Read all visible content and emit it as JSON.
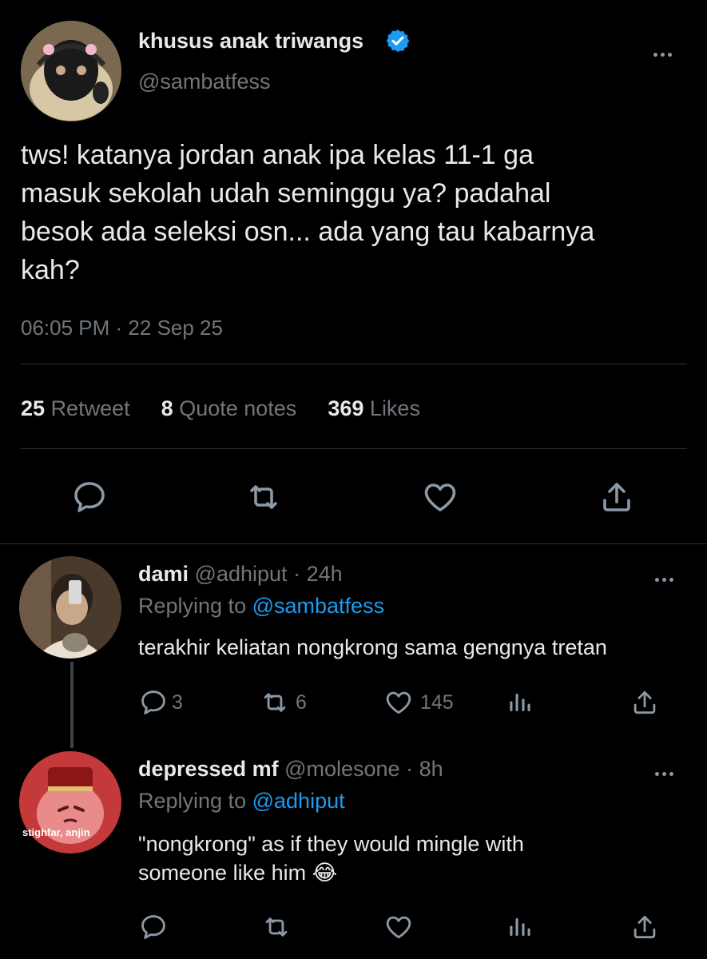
{
  "tweet": {
    "display_name": "khusus anak triwangs",
    "handle": "@sambatfess",
    "text_lines": [
      "tws! katanya jordan anak ipa kelas 11-1 ga",
      "masuk sekolah udah seminggu ya? padahal",
      "besok ada seleksi osn... ada yang tau kabarnya",
      "kah?"
    ],
    "time": "06:05 PM",
    "date": "22 Sep 25",
    "stats": {
      "retweets": "25",
      "retweets_label": "Retweet",
      "quotes": "8",
      "quotes_label": "Quote notes",
      "likes": "369",
      "likes_label": "Likes"
    }
  },
  "replies": [
    {
      "name": "dami",
      "handle": "@adhiput",
      "time": "24h",
      "replying_prefix": "Replying to",
      "replying_to": "@sambatfess",
      "text_lines": [
        "terakhir keliatan nongkrong sama gengnya tretan"
      ],
      "replies": "3",
      "retweets": "6",
      "likes": "145"
    },
    {
      "name": "depressed mf",
      "handle": "@molesone",
      "time": "8h",
      "replying_prefix": "Replying to",
      "replying_to": "@adhiput",
      "text_lines": [
        "\"nongkrong\" as if they would mingle with",
        "someone like him"
      ],
      "emoji": "😂",
      "avatar_caption": "stighfar, anjin"
    }
  ],
  "icons": [
    "verified-badge-icon",
    "more-icon",
    "reply-icon",
    "retweet-icon",
    "heart-icon",
    "share-icon",
    "analytics-icon"
  ],
  "colors": {
    "accent": "#1d9bf0",
    "muted": "#71767b",
    "text": "#e7e9ea",
    "divider": "#2f3336"
  }
}
